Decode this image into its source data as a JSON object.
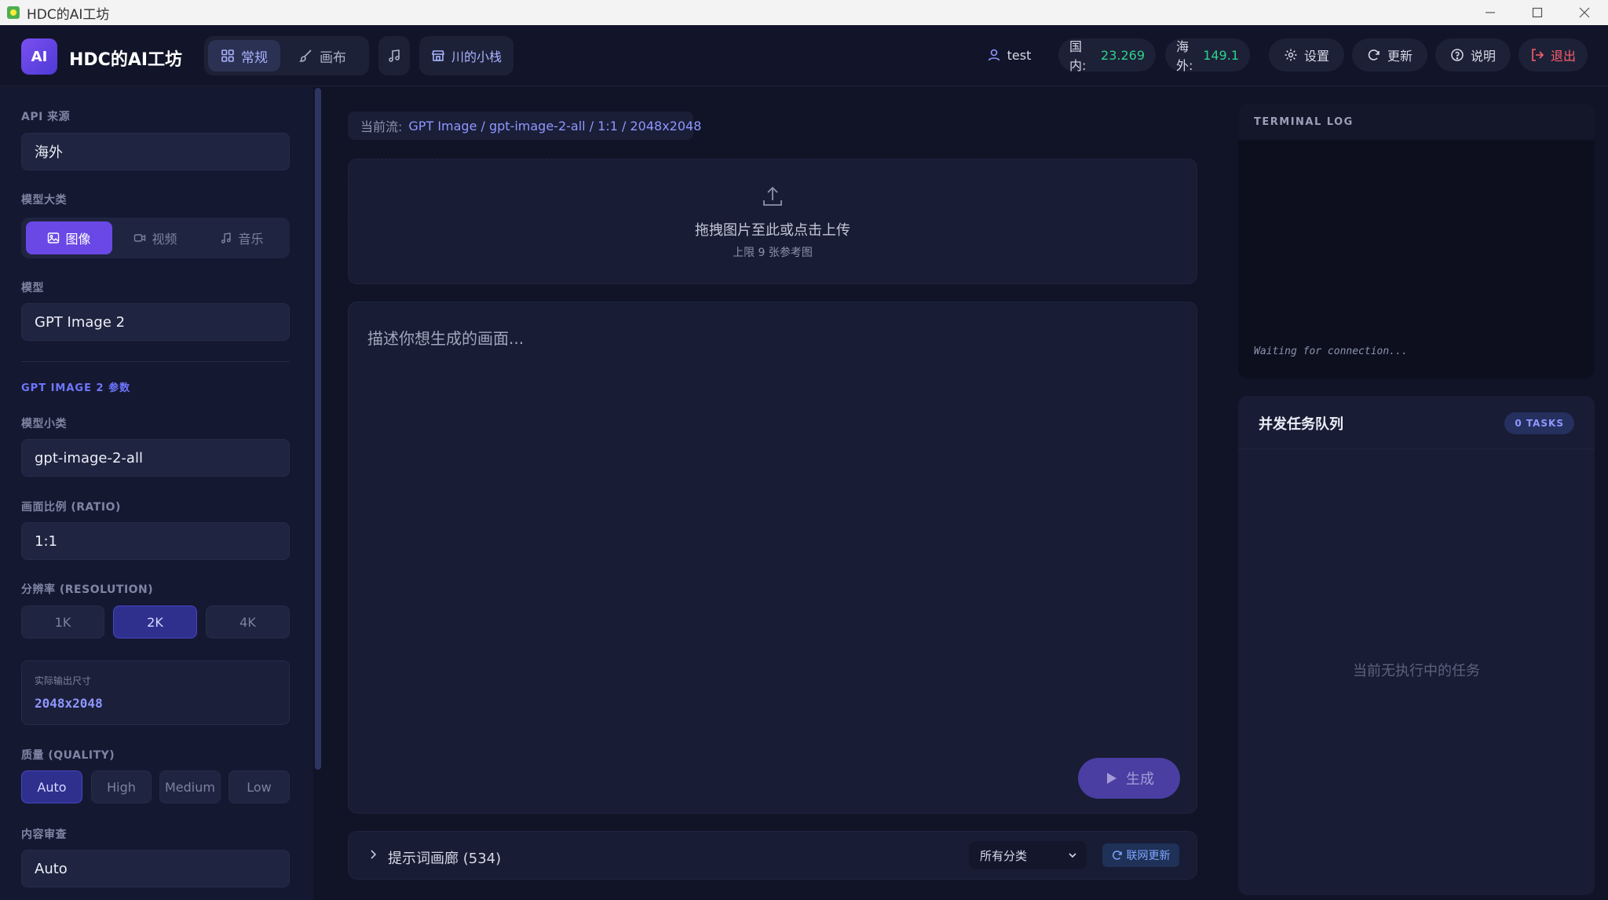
{
  "window": {
    "title": "HDC的AI工坊"
  },
  "header": {
    "brand": "HDC的AI工坊",
    "logo_text": "AI",
    "tabs": [
      {
        "label": "常规",
        "icon": "grid-icon",
        "active": true
      },
      {
        "label": "画布",
        "icon": "brush-icon",
        "active": false
      }
    ],
    "music_icon": "music-icon",
    "store_label": "川的小栈",
    "user": "test",
    "domestic_label": "国内:",
    "domestic_value": "23.269",
    "overseas_label": "海外:",
    "overseas_value": "149.1",
    "settings_label": "设置",
    "update_label": "更新",
    "help_label": "说明",
    "logout_label": "退出"
  },
  "sidebar": {
    "api_source_label": "API 来源",
    "api_source_value": "海外",
    "model_category_label": "模型大类",
    "categories": [
      {
        "label": "图像",
        "icon": "image-icon",
        "active": true
      },
      {
        "label": "视频",
        "icon": "video-icon",
        "active": false
      },
      {
        "label": "音乐",
        "icon": "music-icon",
        "active": false
      }
    ],
    "model_label": "模型",
    "model_value": "GPT Image 2",
    "params_title": "GPT IMAGE 2 参数",
    "submodel_label": "模型小类",
    "submodel_value": "gpt-image-2-all",
    "ratio_label": "画面比例 (RATIO)",
    "ratio_value": "1:1",
    "resolution_label": "分辨率 (RESOLUTION)",
    "resolutions": [
      {
        "label": "1K",
        "active": false
      },
      {
        "label": "2K",
        "active": true
      },
      {
        "label": "4K",
        "active": false
      }
    ],
    "output_label": "实际输出尺寸",
    "output_value": "2048x2048",
    "quality_label": "质量 (QUALITY)",
    "qualities": [
      {
        "label": "Auto",
        "active": true
      },
      {
        "label": "High",
        "active": false
      },
      {
        "label": "Medium",
        "active": false
      },
      {
        "label": "Low",
        "active": false
      }
    ],
    "moderation_label": "内容审查",
    "moderation_value": "Auto"
  },
  "main": {
    "current_flow_label": "当前流:",
    "current_flow_path": "GPT Image / gpt-image-2-all / 1:1 / 2048x2048",
    "upload_title": "拖拽图片至此或点击上传",
    "upload_subtitle": "上限 9 张参考图",
    "prompt_placeholder": "描述你想生成的画面...",
    "generate_label": "生成",
    "gallery_label": "提示词画廊 (534)",
    "category_select": "所有分类",
    "online_update_label": "联网更新"
  },
  "right": {
    "terminal_title": "TERMINAL LOG",
    "terminal_status": "Waiting for connection...",
    "queue_title": "并发任务队列",
    "queue_badge": "0 TASKS",
    "queue_empty": "当前无执行中的任务"
  },
  "colors": {
    "accent": "#6a48e6",
    "background": "#111427",
    "panel": "#181c34",
    "green": "#2fd18c",
    "red": "#ff5e6c"
  }
}
